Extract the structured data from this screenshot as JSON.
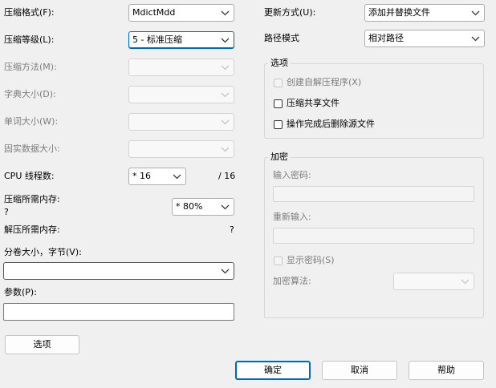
{
  "left": {
    "format": {
      "label": "压缩格式(F):",
      "value": "MdictMdd"
    },
    "level": {
      "label": "压缩等级(L):",
      "value": "5 - 标准压缩"
    },
    "method": {
      "label": "压缩方法(M):",
      "value": ""
    },
    "dict_size": {
      "label": "字典大小(D):",
      "value": ""
    },
    "word_size": {
      "label": "单词大小(W):",
      "value": ""
    },
    "solid_size": {
      "label": "固实数据大小:",
      "value": ""
    },
    "threads": {
      "label": "CPU 线程数:",
      "value": "* 16",
      "total": "/ 16"
    },
    "mem_compress": {
      "label": "压缩所需内存:",
      "value": "?",
      "percent": "* 80%"
    },
    "mem_decompress": {
      "label": "解压所需内存:",
      "value": "?"
    },
    "volume": {
      "label": "分卷大小，字节(V):",
      "value": ""
    },
    "params": {
      "label": "参数(P):",
      "value": ""
    },
    "options_button": "选项"
  },
  "right": {
    "update_mode": {
      "label": "更新方式(U):",
      "value": "添加并替换文件"
    },
    "path_mode": {
      "label": "路径模式",
      "value": "相对路径"
    },
    "options_group": {
      "title": "选项",
      "items": [
        {
          "label": "创建自解压程序(X)",
          "checked": false,
          "enabled": false
        },
        {
          "label": "压缩共享文件",
          "checked": false,
          "enabled": true
        },
        {
          "label": "操作完成后删除源文件",
          "checked": false,
          "enabled": true
        }
      ]
    },
    "encryption_group": {
      "title": "加密",
      "password_label": "输入密码:",
      "password_value": "",
      "reenter_label": "重新输入:",
      "reenter_value": "",
      "show_password": {
        "label": "显示密码(S)",
        "checked": false,
        "enabled": false
      },
      "method_label": "加密算法:",
      "method_value": ""
    }
  },
  "buttons": {
    "ok": "确定",
    "cancel": "取消",
    "help": "帮助"
  },
  "colors": {
    "accent": "#0067c0",
    "background": "#f0f0f0",
    "disabled_text": "#7d7d7d"
  }
}
